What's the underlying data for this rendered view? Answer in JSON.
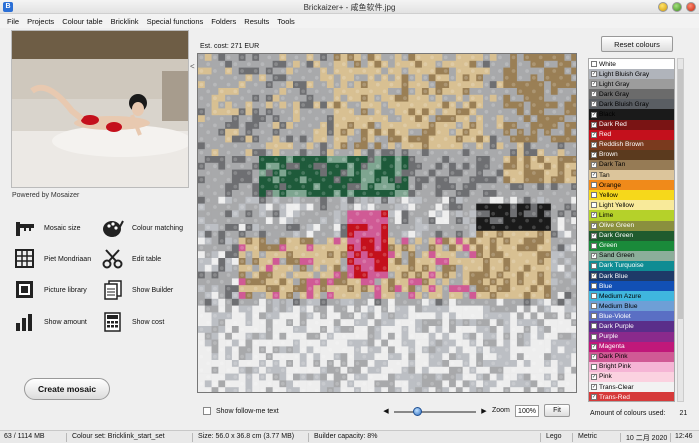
{
  "window": {
    "title": "Brickaizer+ - 咸鱼软件.jpg"
  },
  "menu": [
    "File",
    "Projects",
    "Colour table",
    "Bricklink",
    "Special functions",
    "Folders",
    "Results",
    "Tools"
  ],
  "left": {
    "powered_by": "Powered by Mosaizer",
    "tools": [
      {
        "label": "Mosaic size",
        "icon": "ruler-icon"
      },
      {
        "label": "Colour matching",
        "icon": "palette-icon"
      },
      {
        "label": "Piet Mondriaan",
        "icon": "grid-icon"
      },
      {
        "label": "Edit table",
        "icon": "scissors-icon"
      },
      {
        "label": "Picture library",
        "icon": "picture-frame-icon"
      },
      {
        "label": "Show Builder",
        "icon": "builder-pages-icon"
      },
      {
        "label": "Show amount",
        "icon": "bar-chart-icon"
      },
      {
        "label": "Show cost",
        "icon": "calculator-icon"
      }
    ],
    "create_button": "Create mosaic"
  },
  "center": {
    "estimated_cost": "Est. cost: 271 EUR",
    "collapse_arrow": "<",
    "follow_me_label": "Show follow-me text",
    "zoom_label": "Zoom",
    "zoom_value": "100%",
    "fit_label": "Fit",
    "slider_left": "◀",
    "slider_right": "▶"
  },
  "right": {
    "reset_button": "Reset colours",
    "colors": [
      {
        "name": "White",
        "hex": "#ffffff",
        "checked": false,
        "text": "#000"
      },
      {
        "name": "Light Bluish Gray",
        "hex": "#b0b4bb",
        "checked": true,
        "text": "#000"
      },
      {
        "name": "Light Gray",
        "hex": "#9c9c9c",
        "checked": true,
        "text": "#000"
      },
      {
        "name": "Dark Gray",
        "hex": "#6b6b6b",
        "checked": true,
        "text": "#000"
      },
      {
        "name": "Dark Bluish Gray",
        "hex": "#5a5e63",
        "checked": true,
        "text": "#000"
      },
      {
        "name": "Black",
        "hex": "#1a1a1a",
        "checked": true,
        "text": "#000"
      },
      {
        "name": "Dark Red",
        "hex": "#7a1414",
        "checked": true,
        "text": "#fff"
      },
      {
        "name": "Red",
        "hex": "#c4101c",
        "checked": true,
        "text": "#fff"
      },
      {
        "name": "Reddish Brown",
        "hex": "#7a3a1e",
        "checked": true,
        "text": "#fff"
      },
      {
        "name": "Brown",
        "hex": "#5b3a1e",
        "checked": true,
        "text": "#fff"
      },
      {
        "name": "Dark Tan",
        "hex": "#967b55",
        "checked": true,
        "text": "#000"
      },
      {
        "name": "Tan",
        "hex": "#dcc59b",
        "checked": true,
        "text": "#000"
      },
      {
        "name": "Orange",
        "hex": "#f08a1a",
        "checked": false,
        "text": "#000"
      },
      {
        "name": "Yellow",
        "hex": "#f6d81b",
        "checked": false,
        "text": "#000"
      },
      {
        "name": "Light Yellow",
        "hex": "#f8ea9a",
        "checked": false,
        "text": "#000"
      },
      {
        "name": "Lime",
        "hex": "#b5d12a",
        "checked": true,
        "text": "#000"
      },
      {
        "name": "Olive Green",
        "hex": "#8a8f3e",
        "checked": true,
        "text": "#fff"
      },
      {
        "name": "Dark Green",
        "hex": "#1f5b2e",
        "checked": true,
        "text": "#fff"
      },
      {
        "name": "Green",
        "hex": "#1a8a3a",
        "checked": false,
        "text": "#fff"
      },
      {
        "name": "Sand Green",
        "hex": "#8cae9a",
        "checked": true,
        "text": "#000"
      },
      {
        "name": "Dark Turquoise",
        "hex": "#0f8c93",
        "checked": false,
        "text": "#fff"
      },
      {
        "name": "Dark Blue",
        "hex": "#1e3a68",
        "checked": true,
        "text": "#fff"
      },
      {
        "name": "Blue",
        "hex": "#1250b5",
        "checked": false,
        "text": "#fff"
      },
      {
        "name": "Medium Azure",
        "hex": "#3fb6de",
        "checked": false,
        "text": "#000"
      },
      {
        "name": "Medium Blue",
        "hex": "#6e9fd6",
        "checked": false,
        "text": "#000"
      },
      {
        "name": "Blue-Violet",
        "hex": "#5a6fc4",
        "checked": false,
        "text": "#fff"
      },
      {
        "name": "Dark Purple",
        "hex": "#5a2e8a",
        "checked": false,
        "text": "#fff"
      },
      {
        "name": "Purple",
        "hex": "#8a2a8c",
        "checked": false,
        "text": "#fff"
      },
      {
        "name": "Magenta",
        "hex": "#c0187a",
        "checked": true,
        "text": "#fff"
      },
      {
        "name": "Dark Pink",
        "hex": "#d05a95",
        "checked": true,
        "text": "#000"
      },
      {
        "name": "Bright Pink",
        "hex": "#f5b5d5",
        "checked": false,
        "text": "#000"
      },
      {
        "name": "Pink",
        "hex": "#fbd2e0",
        "checked": true,
        "text": "#000"
      },
      {
        "name": "Trans-Clear",
        "hex": "#f2f2f2",
        "checked": true,
        "text": "#000"
      },
      {
        "name": "Trans-Red",
        "hex": "#d63a3a",
        "checked": true,
        "text": "#fff"
      }
    ],
    "amount_label": "Amount of colours used:",
    "amount_value": "21"
  },
  "status": {
    "memory": "63 / 1114 MB",
    "colour_set": "Colour set: Bricklink_start_set",
    "size": "Size: 56.0 x 36.8 cm (3.77 MB)",
    "capacity": "Builder capacity: 8%",
    "brand": "Lego",
    "units": "Metric",
    "date": "10 二月 2020",
    "time": "12:46"
  }
}
